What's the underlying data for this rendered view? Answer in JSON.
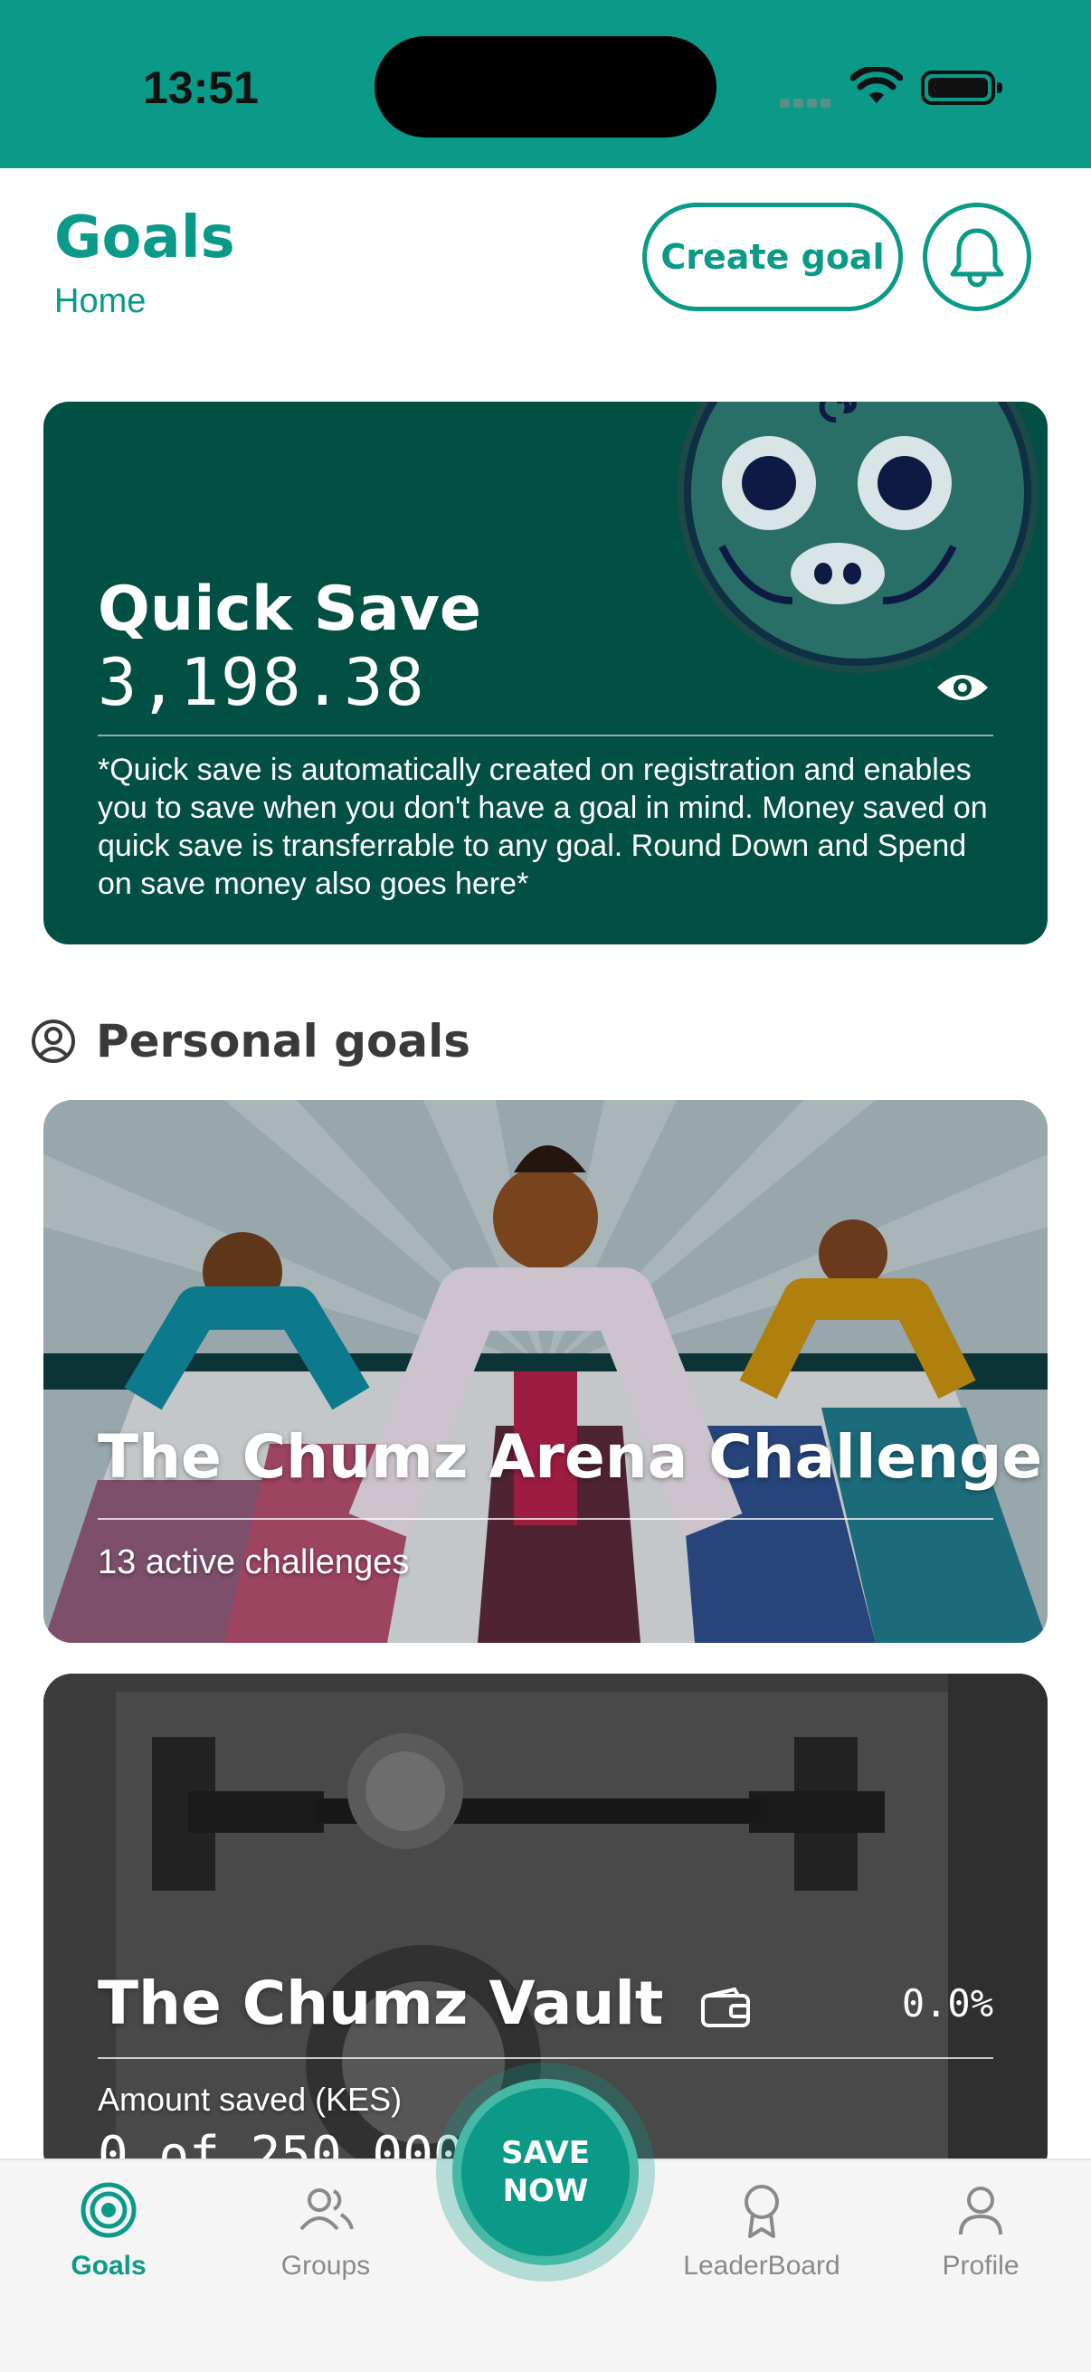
{
  "status_bar": {
    "time": "13:51"
  },
  "header": {
    "title": "Goals",
    "breadcrumb": "Home",
    "create_goal_label": "Create goal"
  },
  "quick_save": {
    "title": "Quick Save",
    "amount": "3,198.38",
    "note": "*Quick save is automatically created on registration and enables you to save when you don't have a goal in mind. Money saved on quick save is transferrable to any goal. Round Down and Spend on save money also goes here*"
  },
  "personal_goals": {
    "section_title": "Personal goals",
    "cards": [
      {
        "title": "The Chumz Arena Challenge",
        "subtitle": "13 active challenges"
      },
      {
        "title": "The Chumz Vault",
        "percent": "0.0%",
        "amount_label": "Amount saved (KES)",
        "amount_value": "0 of 250,000"
      }
    ]
  },
  "bottom_nav": {
    "items": [
      {
        "label": "Goals",
        "active": true
      },
      {
        "label": "Groups",
        "active": false
      },
      {
        "label": "LeaderBoard",
        "active": false
      },
      {
        "label": "Profile",
        "active": false
      }
    ],
    "save_now": {
      "line1": "SAVE",
      "line2": "NOW"
    }
  },
  "colors": {
    "accent": "#0a9a87",
    "quick_save_bg": "#024f43",
    "nav_inactive": "#8a8a8a"
  },
  "icons": [
    "wifi-icon",
    "battery-icon",
    "bell-icon",
    "eye-icon",
    "user-circle-icon",
    "wallet-icon",
    "target-icon",
    "groups-icon",
    "award-icon",
    "profile-icon"
  ]
}
